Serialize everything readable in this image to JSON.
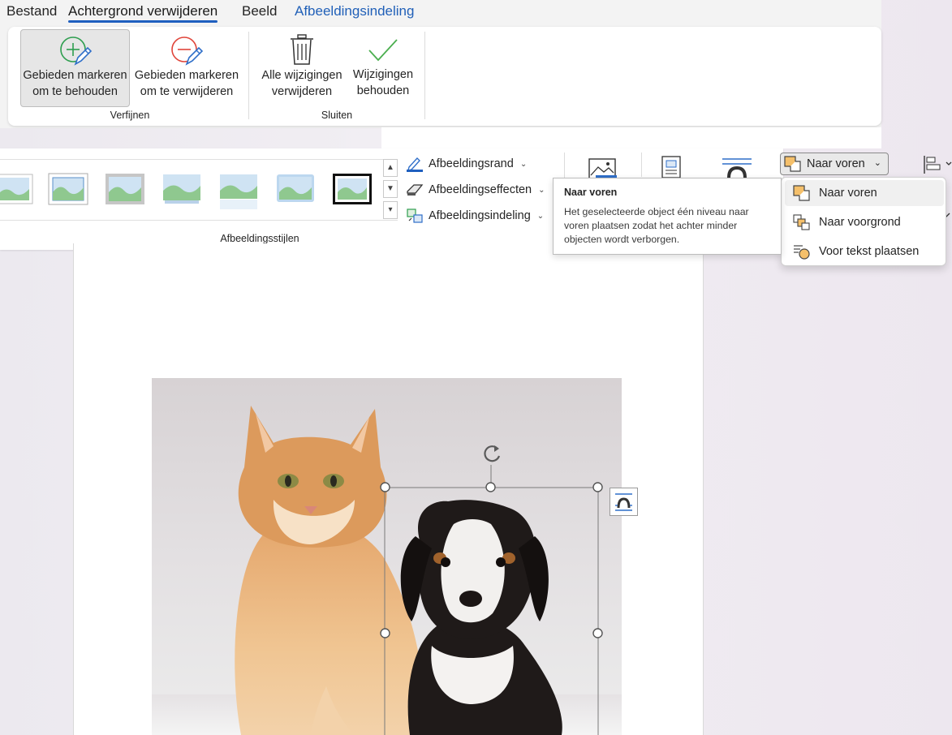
{
  "tabs": [
    {
      "label": "Bestand"
    },
    {
      "label": "Achtergrond verwijderen"
    },
    {
      "label": "Beeld"
    },
    {
      "label": "Afbeeldingsindeling"
    }
  ],
  "refine": {
    "keep_label_1": "Gebieden markeren",
    "keep_label_2": "om te behouden",
    "remove_label_1": "Gebieden markeren",
    "remove_label_2": "om te verwijderen",
    "group_label": "Verfijnen"
  },
  "close": {
    "discard_label_1": "Alle wijzigingen",
    "discard_label_2": "verwijderen",
    "keep_label_1": "Wijzigingen",
    "keep_label_2": "behouden",
    "group_label": "Sluiten"
  },
  "picture_format": {
    "border_label": "Afbeeldingsrand",
    "effects_label": "Afbeeldingseffecten",
    "layout_label": "Afbeeldingsindeling",
    "styles_group_label": "Afbeeldingsstijlen",
    "style_count": 7
  },
  "bring_forward": {
    "button_label": "Naar voren",
    "menu": [
      {
        "label": "Naar voren",
        "icon": "bring-forward-icon"
      },
      {
        "label": "Naar voorgrond",
        "icon": "bring-to-front-icon"
      },
      {
        "label": "Voor tekst plaatsen",
        "icon": "in-front-of-text-icon"
      }
    ]
  },
  "tooltip": {
    "title": "Naar voren",
    "body": "Het geselecteerde object één niveau naar voren plaatsen zodat het achter minder objecten wordt verborgen."
  },
  "colors": {
    "accent": "#1f5fbf",
    "add_green": "#2e9e4f",
    "remove_red": "#e0453a",
    "check_green": "#4caf50",
    "selection_orange": "#f5b942"
  }
}
